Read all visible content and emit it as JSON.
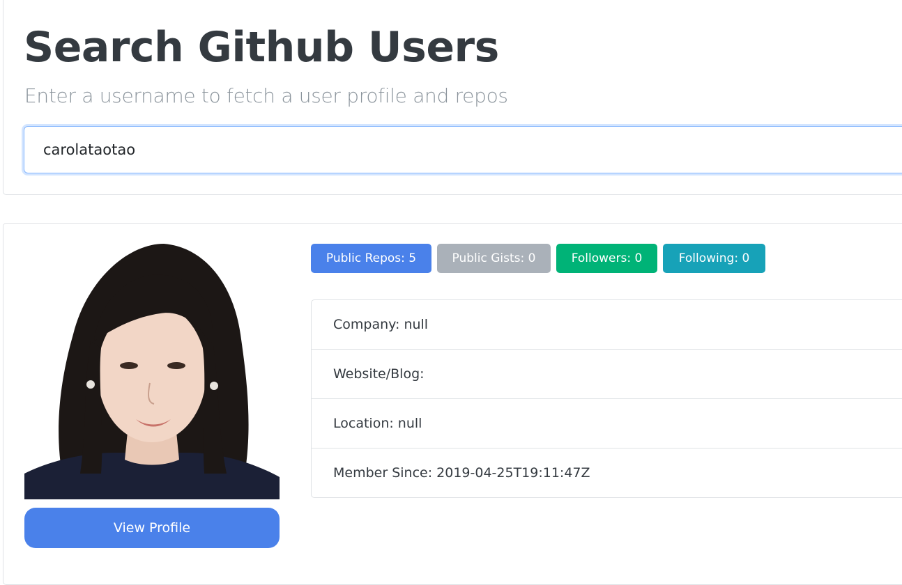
{
  "header": {
    "title": "Search Github Users",
    "subtitle": "Enter a username to fetch a user profile and repos"
  },
  "search": {
    "value": "carolataotao"
  },
  "profile": {
    "avatar_icon": "profile-photo",
    "view_profile_label": "View Profile",
    "badges": [
      {
        "label": "Public Repos: 5",
        "color": "#4a81ea"
      },
      {
        "label": "Public Gists: 0",
        "color": "#aab1b9"
      },
      {
        "label": "Followers: 0",
        "color": "#00b377"
      },
      {
        "label": "Following: 0",
        "color": "#17a2b8"
      }
    ],
    "details": [
      "Company: null",
      "Website/Blog:",
      "Location: null",
      "Member Since: 2019-04-25T19:11:47Z"
    ]
  }
}
